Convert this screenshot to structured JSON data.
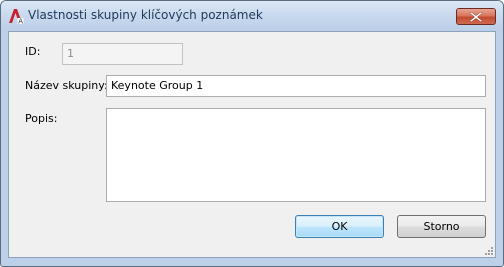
{
  "window": {
    "title": "Vlastnosti skupiny klíčových poznámek"
  },
  "icons": {
    "app": "autocad-a-icon",
    "close": "close-x-icon",
    "grip": "resize-grip-icon"
  },
  "colors": {
    "close_button": "#c24b30",
    "title_text": "#1e395b"
  },
  "form": {
    "id_label": "ID:",
    "id_value": "1",
    "name_label": "Název skupiny:",
    "name_value": "Keynote Group 1",
    "desc_label": "Popis:",
    "desc_value": ""
  },
  "buttons": {
    "ok": "OK",
    "cancel": "Storno"
  }
}
